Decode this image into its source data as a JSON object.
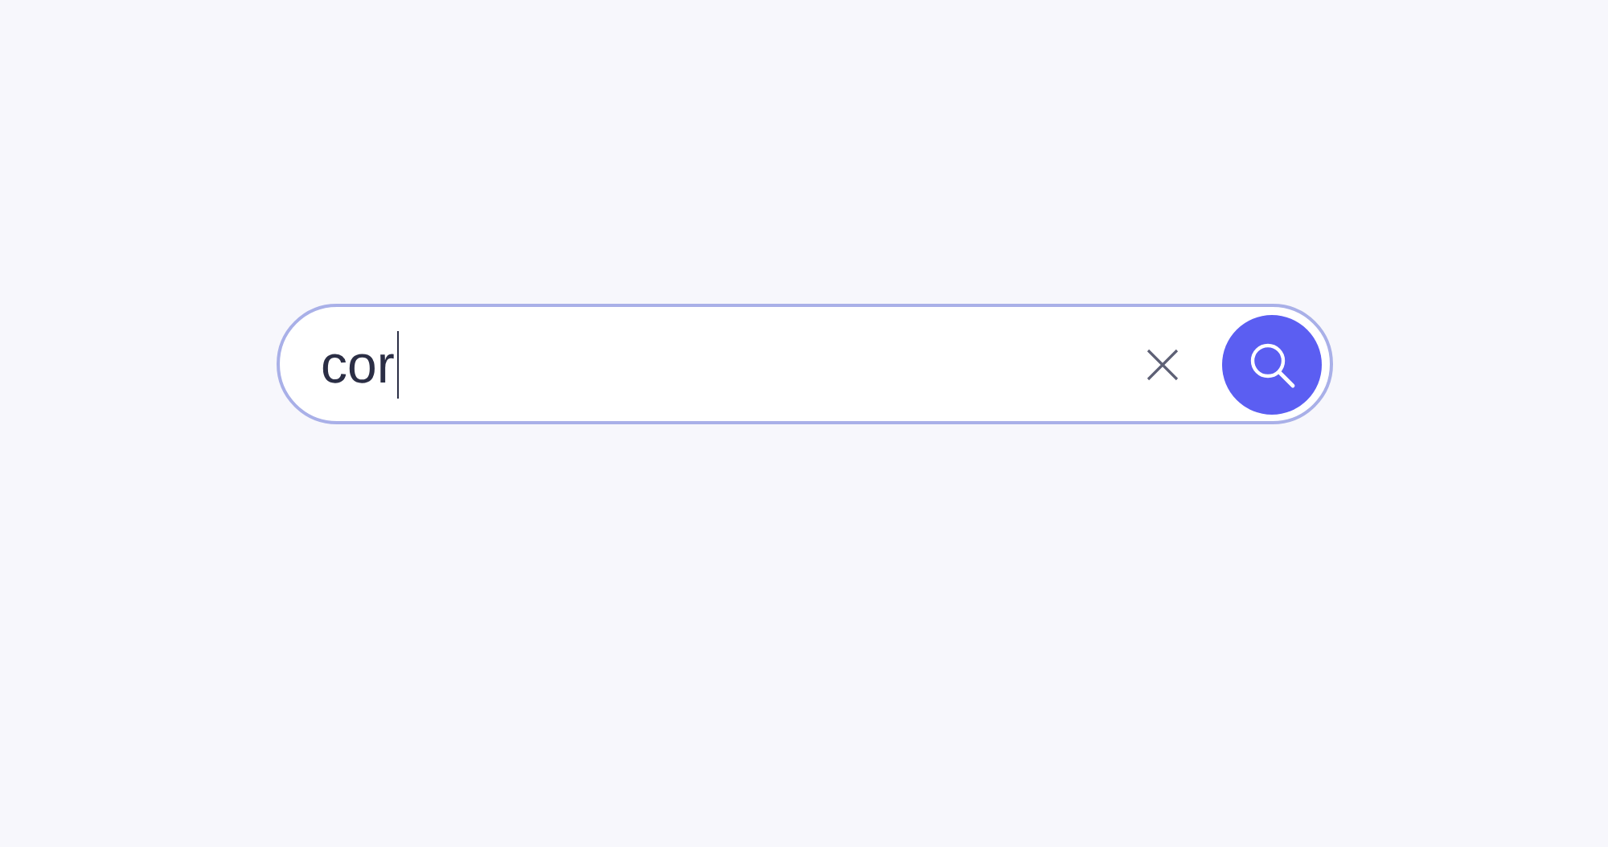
{
  "search": {
    "value": "cor",
    "focused": true
  }
}
